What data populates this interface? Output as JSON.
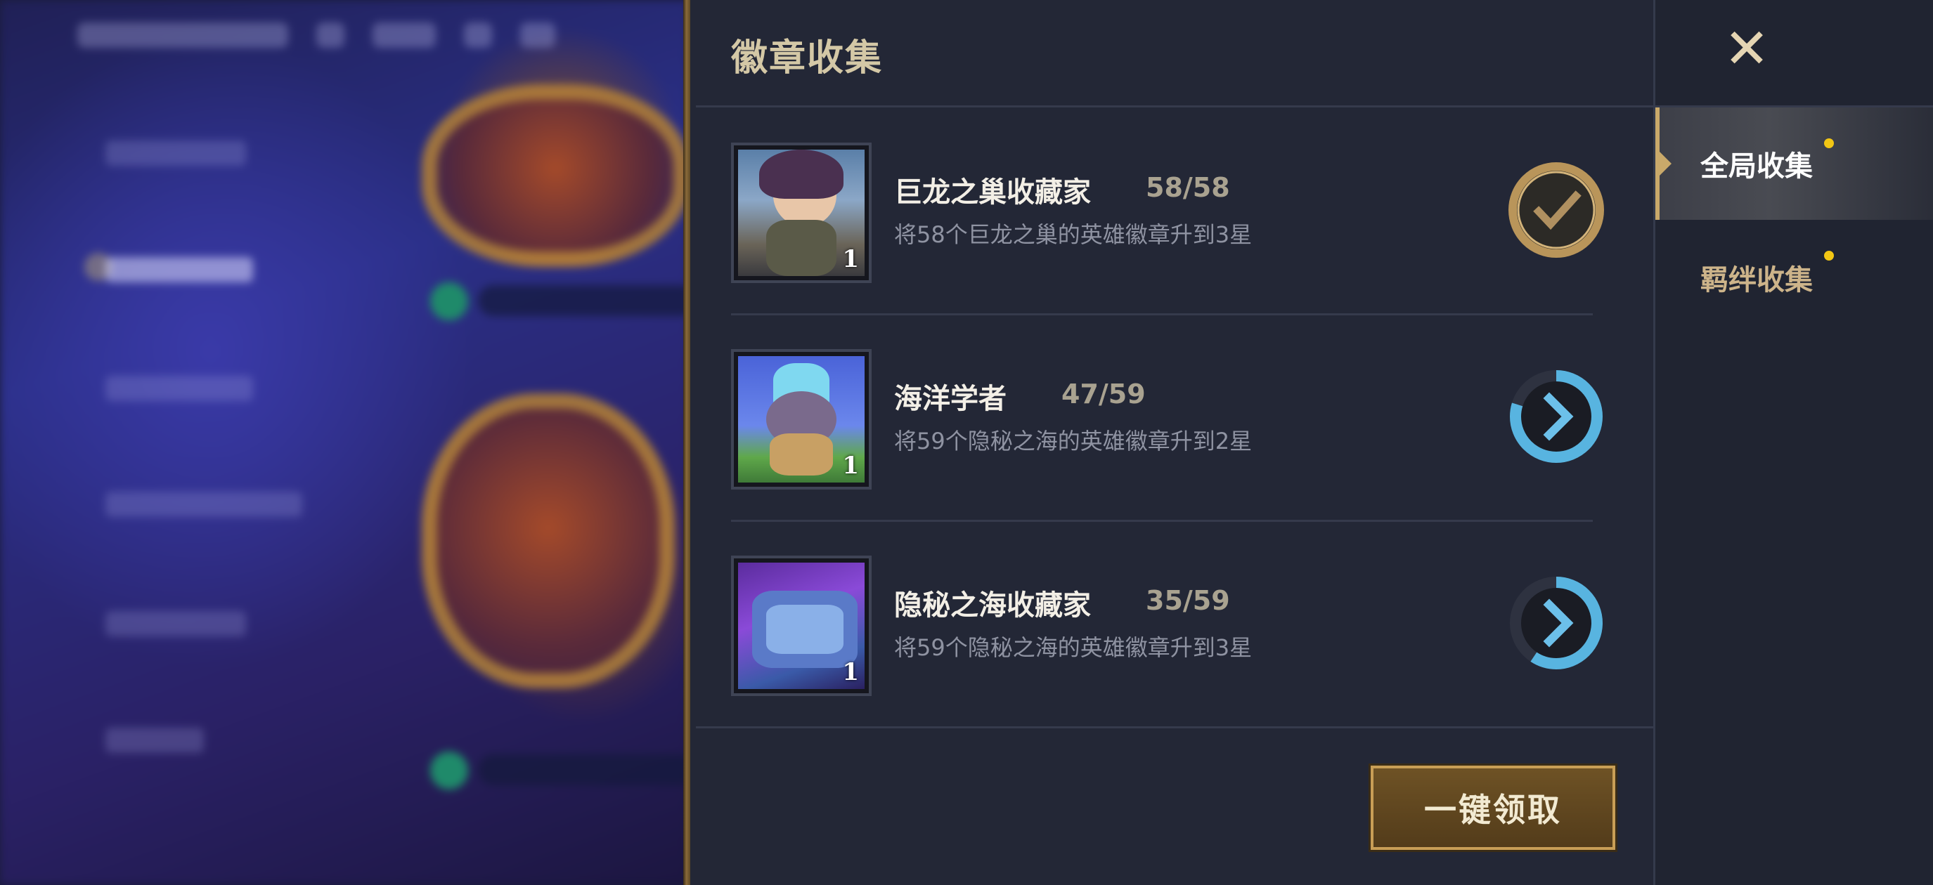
{
  "panel": {
    "title": "徽章收集",
    "claim_all_label": "一键领取"
  },
  "tabs": [
    {
      "label": "全局收集",
      "active": true,
      "has_notification": true
    },
    {
      "label": "羁绊收集",
      "active": false,
      "has_notification": true
    }
  ],
  "close_icon": "close-icon",
  "collections": [
    {
      "name": "巨龙之巢收藏家",
      "progress": "58/58",
      "description": "将58个巨龙之巢的英雄徽章升到3星",
      "badge_level": "1",
      "status": "completed",
      "status_icon": "check-icon",
      "completion": 1.0
    },
    {
      "name": "海洋学者",
      "progress": "47/59",
      "description": "将59个隐秘之海的英雄徽章升到2星",
      "badge_level": "1",
      "status": "in_progress",
      "status_icon": "chevron-right-icon",
      "completion": 0.797
    },
    {
      "name": "隐秘之海收藏家",
      "progress": "35/59",
      "description": "将59个隐秘之海的英雄徽章升到3星",
      "badge_level": "1",
      "status": "in_progress",
      "status_icon": "chevron-right-icon",
      "completion": 0.593
    }
  ],
  "colors": {
    "gold": "#c9a96a",
    "progress_blue": "#58b4e0",
    "notification": "#f2c614"
  }
}
